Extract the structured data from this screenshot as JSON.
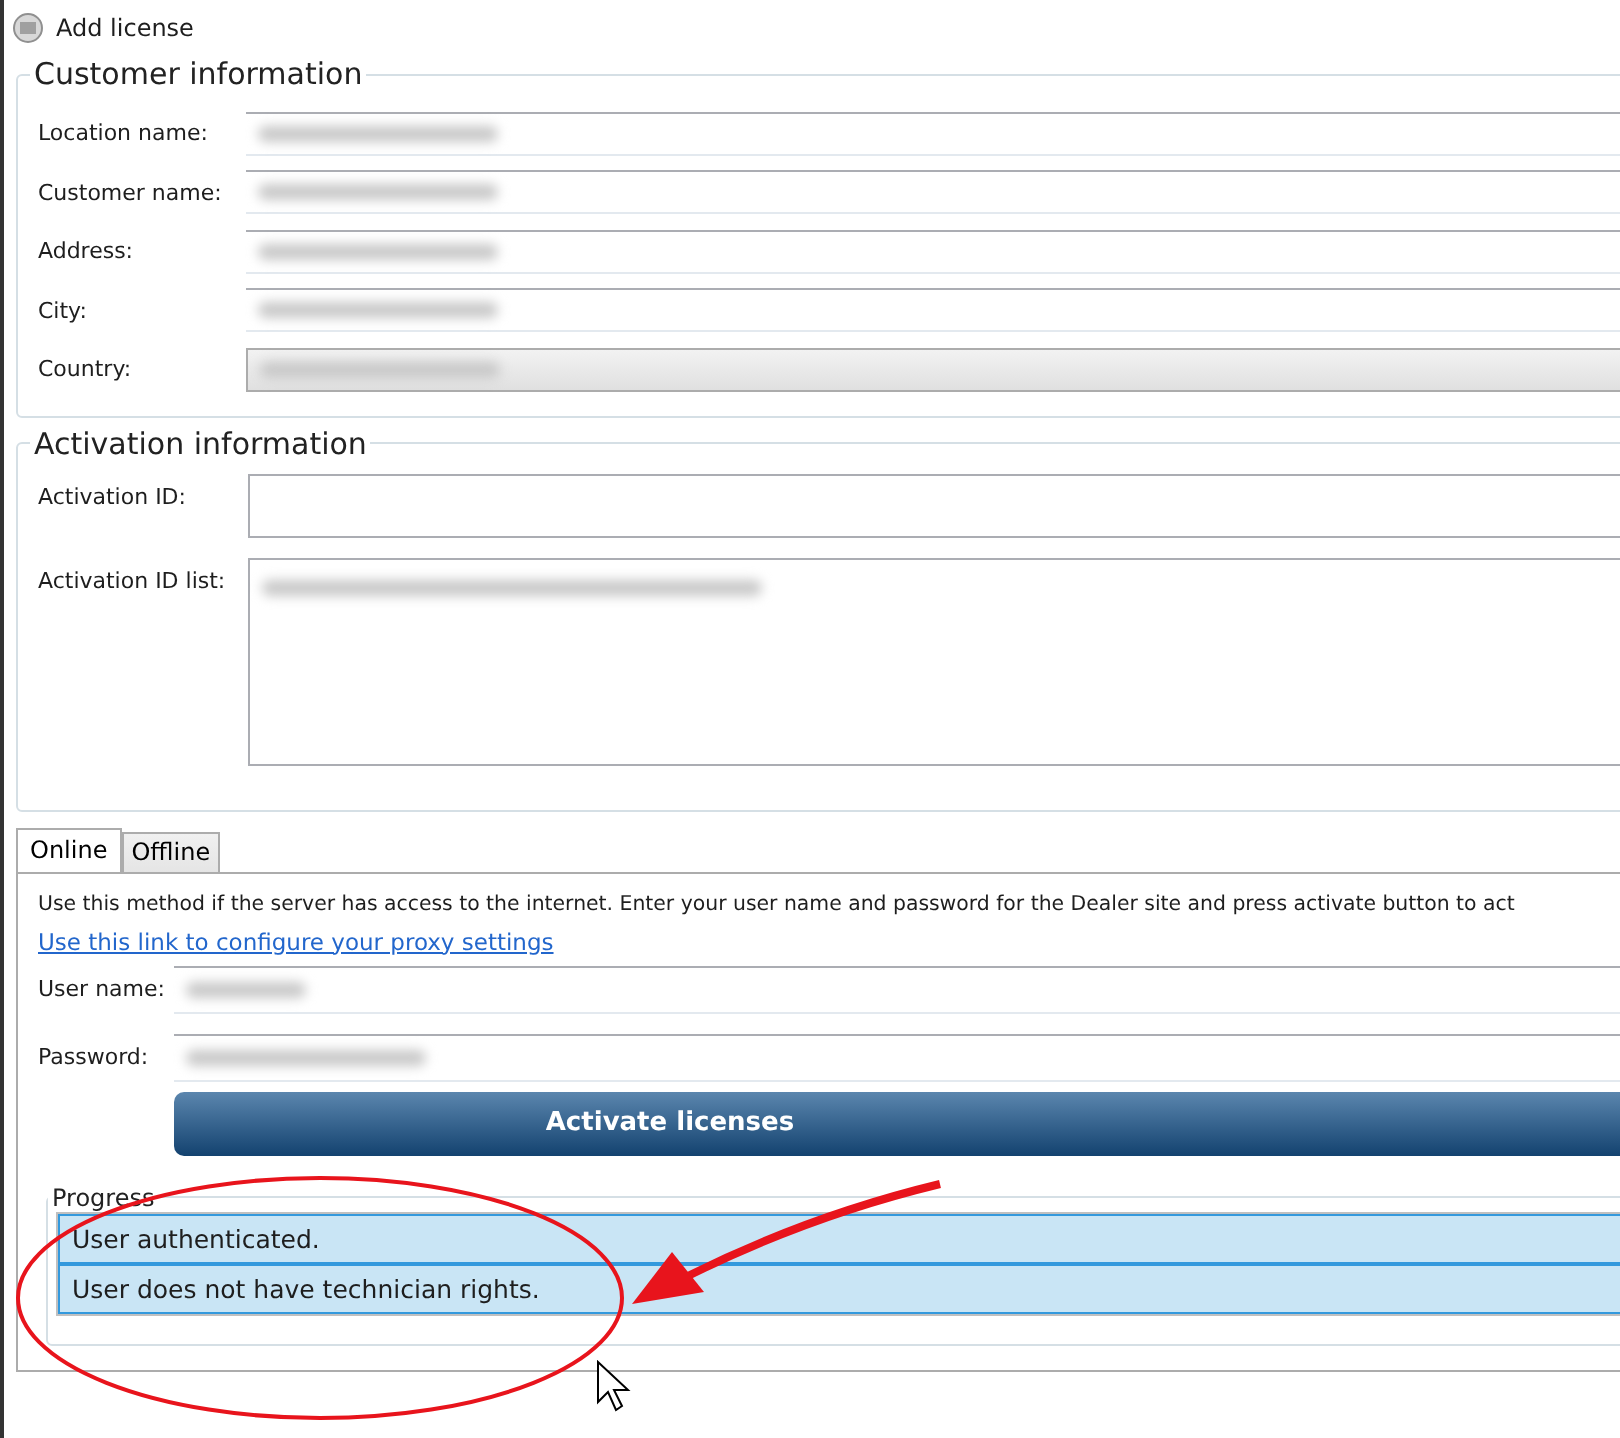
{
  "window": {
    "title": "Add license"
  },
  "customer_information": {
    "title": "Customer information",
    "fields": [
      {
        "label": "Location name:",
        "kind": "text"
      },
      {
        "label": "Customer name:",
        "kind": "text"
      },
      {
        "label": "Address:",
        "kind": "text"
      },
      {
        "label": "City:",
        "kind": "text"
      },
      {
        "label": "Country:",
        "kind": "dropdown"
      }
    ]
  },
  "activation_information": {
    "title": "Activation information",
    "activation_id": {
      "label": "Activation ID:"
    },
    "activation_id_list": {
      "label": "Activation ID list:"
    }
  },
  "tabs": [
    {
      "label": "Online",
      "selected": true
    },
    {
      "label": "Offline",
      "selected": false
    }
  ],
  "online": {
    "description": "Use this method if the server has access to the internet. Enter your user name and password for the Dealer site and press activate button to act",
    "proxy_link": "Use this link to configure your proxy settings",
    "user_name": {
      "label": "User name:"
    },
    "password": {
      "label": "Password:"
    },
    "activate_button": "Activate licenses"
  },
  "progress": {
    "title": "Progress",
    "rows": [
      {
        "text": "User authenticated.",
        "selected": true
      },
      {
        "text": "User does not have technician rights.",
        "selected": true
      }
    ]
  }
}
